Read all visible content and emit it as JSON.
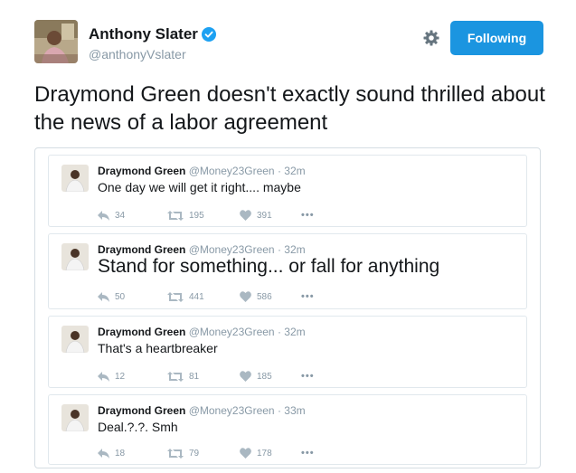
{
  "author": {
    "name": "Anthony Slater",
    "handle": "@anthonyVslater"
  },
  "follow_button": {
    "label": "Following"
  },
  "tweet": {
    "text": "Draymond Green doesn't exactly sound thrilled about the news of a labor agreement"
  },
  "embedded": [
    {
      "name": "Draymond Green",
      "handle": "@Money23Green",
      "time": "· 32m",
      "text": "One day we will get it right.... maybe",
      "replies": "34",
      "retweets": "195",
      "likes": "391"
    },
    {
      "name": "Draymond Green",
      "handle": "@Money23Green",
      "time": "· 32m",
      "text": "Stand for something... or fall for anything",
      "replies": "50",
      "retweets": "441",
      "likes": "586"
    },
    {
      "name": "Draymond Green",
      "handle": "@Money23Green",
      "time": "· 32m",
      "text": "That's a heartbreaker",
      "replies": "12",
      "retweets": "81",
      "likes": "185"
    },
    {
      "name": "Draymond Green",
      "handle": "@Money23Green",
      "time": "· 33m",
      "text": "Deal.?.?. Smh",
      "replies": "18",
      "retweets": "79",
      "likes": "178"
    }
  ],
  "icons": {
    "verified": "verified-badge-icon",
    "settings": "gear-icon",
    "reply": "reply-icon",
    "retweet": "retweet-icon",
    "like": "heart-icon",
    "more": "more-dots-icon"
  },
  "colors": {
    "accent": "#1b95e0",
    "muted": "#8899a6",
    "text": "#14171a"
  }
}
